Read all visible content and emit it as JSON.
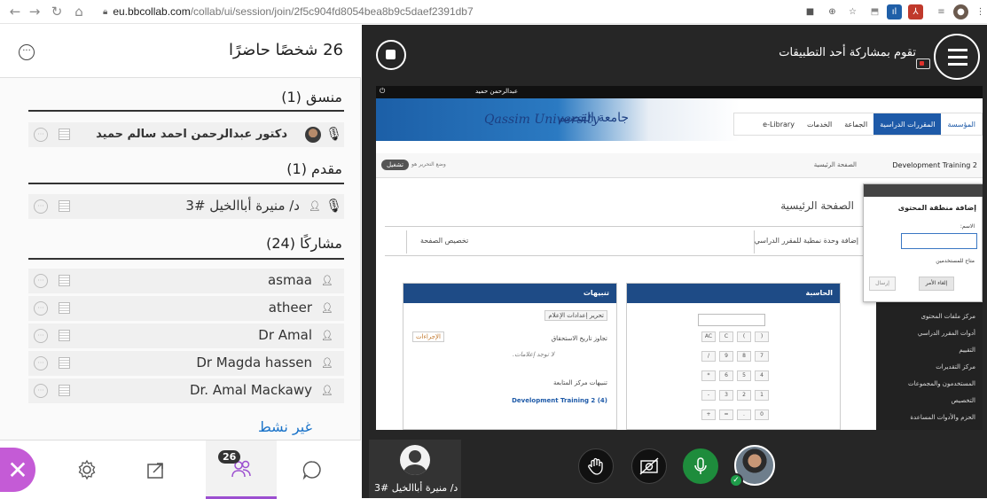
{
  "browser": {
    "url_host": "eu.bbcollab.com",
    "url_path": "/collab/ui/session/join/2f5c904fd8054bea8b9c5daef2391db7"
  },
  "left_panel": {
    "title": "26 شخصًا حاضرًا",
    "moderator_section": "منسق (1)",
    "moderator_name": "دكتور عبدالرحمن احمد سالم حميد",
    "presenter_section": "مقدم (1)",
    "presenter_name": "د/ منيرة أباالخيل #3",
    "participants_section": "مشاركًا (24)",
    "participants": [
      "asmaa",
      "atheer",
      "Dr Amal",
      "Dr Magda hassen",
      "Dr. Amal Mackawy"
    ],
    "inactive_label": "غير نشط",
    "attendee_count": "26"
  },
  "stage": {
    "share_label": "تقوم بمشاركة أحد التطبيقات",
    "self_name": "د/ منيرة أباالخيل #3"
  },
  "shared_screen": {
    "user_label": "عبدالرحمن حميد",
    "logo_en": "Qassim University",
    "logo_ar": "جامعة القصيم",
    "nav": [
      "المؤسسة",
      "المقررات الدراسية",
      "الجماعة",
      "الخدمات",
      "e-Library"
    ],
    "course_name": "Development Training 2",
    "home_crumb": "الصفحة الرئيسية",
    "toggle_label": "تشغيل",
    "toggle_text": "وضع التحرير هو",
    "page_title": "الصفحة الرئيسية",
    "actions": [
      "إضافة وحدة نمطية للمقرر الدراسي",
      "تخصيص الصفحة"
    ],
    "popup": {
      "title": "إضافة منطقة المحتوى",
      "name_label": "الاسم:",
      "available_label": "متاح للمستخدمين",
      "submit_label": "إرسال",
      "cancel_label": "إلغاء الأمر"
    },
    "side_menu": [
      "مركز ملفات المحتوى",
      "أدوات المقرر الدراسي",
      "التقييم",
      "مركز التقديرات",
      "المستخدمون والمجموعات",
      "التخصيص",
      "الحزم والأدوات المساعدة"
    ],
    "calculator_title": "الحاسبة",
    "alerts_title": "تنبيهات",
    "alerts_edit": "تحرير إعدادات الإعلام",
    "alerts_actions": "الإجراءات",
    "alerts_due": "تجاوز تاريخ الاستحقاق",
    "alerts_none": "لا توجد إعلامات.",
    "alerts_tracking": "تنبيهات مركز المتابعة",
    "alerts_course": "Development Training 2 (4)",
    "calc_keys": [
      "AC",
      "C",
      "(",
      ")",
      "/",
      "9",
      "8",
      "7",
      "*",
      "6",
      "5",
      "4",
      "-",
      "3",
      "2",
      "1",
      "+",
      "=",
      ".",
      "0"
    ]
  }
}
